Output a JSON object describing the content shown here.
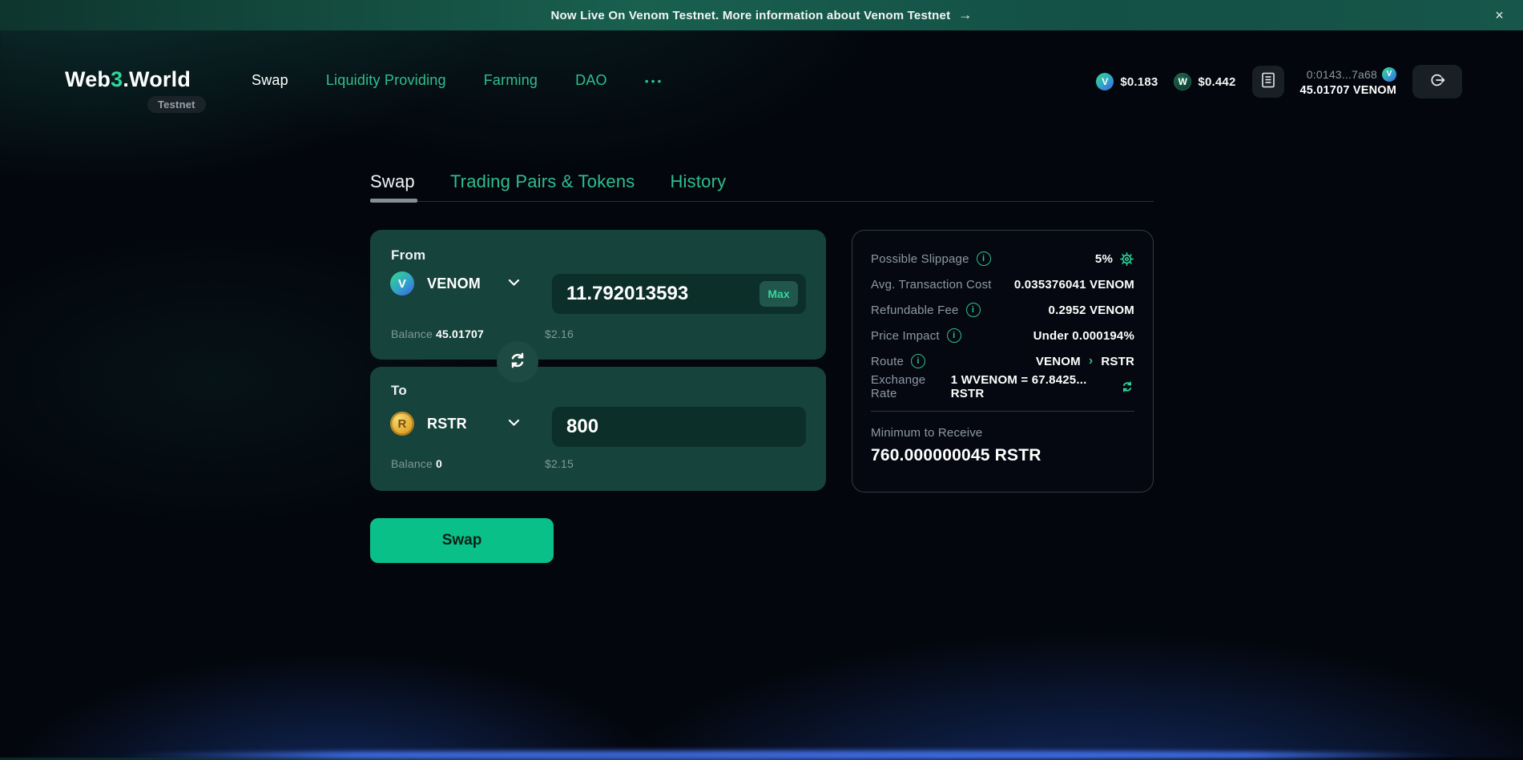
{
  "banner": {
    "text": "Now Live On Venom Testnet. More information about Venom Testnet",
    "arrow": "→",
    "close": "×"
  },
  "header": {
    "logo": {
      "web": "Web",
      "three": "3",
      "world": ".World"
    },
    "badge": "Testnet",
    "nav": [
      {
        "label": "Swap"
      },
      {
        "label": "Liquidity Providing"
      },
      {
        "label": "Farming"
      },
      {
        "label": "DAO"
      },
      {
        "label": "•••"
      }
    ],
    "price_venom": {
      "symbol": "V",
      "value": "$0.183"
    },
    "price_w3w": {
      "symbol": "W",
      "value": "$0.442"
    },
    "wallet": {
      "address": "0:0143...7a68",
      "icon_symbol": "V",
      "balance": "45.01707 VENOM"
    }
  },
  "tabs": [
    {
      "label": "Swap"
    },
    {
      "label": "Trading Pairs & Tokens"
    },
    {
      "label": "History"
    }
  ],
  "swap": {
    "from": {
      "label": "From",
      "token": "VENOM",
      "token_symbol": "V",
      "amount": "11.792013593",
      "max": "Max",
      "balance_label": "Balance",
      "balance": "45.01707",
      "usd": "$2.16"
    },
    "to": {
      "label": "To",
      "token": "RSTR",
      "token_symbol": "R",
      "amount": "800",
      "balance_label": "Balance",
      "balance": "0",
      "usd": "$2.15"
    },
    "submit": "Swap"
  },
  "details": {
    "possible_slippage": {
      "label": "Possible Slippage",
      "value": "5%"
    },
    "avg_cost": {
      "label": "Avg. Transaction Cost",
      "value": "0.035376041 VENOM"
    },
    "refundable_fee": {
      "label": "Refundable Fee",
      "value": "0.2952 VENOM"
    },
    "price_impact": {
      "label": "Price Impact",
      "value": "Under 0.000194%"
    },
    "route": {
      "label": "Route",
      "from": "VENOM",
      "chevron": "›",
      "to": "RSTR"
    },
    "exchange_rate": {
      "label": "Exchange Rate",
      "value": "1 WVENOM = 67.8425... RSTR"
    },
    "minimum_receive": {
      "label": "Minimum to Receive",
      "value": "760.000000045 RSTR"
    }
  },
  "icons": {
    "info": "i"
  },
  "colors": {
    "accent_green": "#2fbf8f",
    "bright_green": "#2fd699",
    "button_green": "#0ac089",
    "panel_green": "#16433c",
    "input_green": "#0c2f29",
    "banner_green": "#19604f",
    "venom_blue": "#3b6ee6",
    "coin_gold": "#e0a92f",
    "muted_text": "#8d99a6"
  }
}
